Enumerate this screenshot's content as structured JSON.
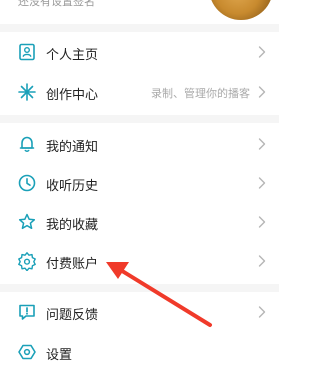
{
  "profile": {
    "status_text": "还没有设置签名"
  },
  "colors": {
    "accent": "#1aa0b8",
    "annotation_arrow": "#f03a2a"
  },
  "menu": {
    "group1": [
      {
        "label": "个人主页",
        "icon": "profile-page-icon",
        "hint": ""
      },
      {
        "label": "创作中心",
        "icon": "creation-center-icon",
        "hint": "录制、管理你的播客"
      }
    ],
    "group2": [
      {
        "label": "我的通知",
        "icon": "bell-icon",
        "hint": ""
      },
      {
        "label": "收听历史",
        "icon": "clock-icon",
        "hint": ""
      },
      {
        "label": "我的收藏",
        "icon": "star-icon",
        "hint": ""
      },
      {
        "label": "付费账户",
        "icon": "paid-badge-icon",
        "hint": ""
      }
    ],
    "group3": [
      {
        "label": "问题反馈",
        "icon": "feedback-icon",
        "hint": ""
      },
      {
        "label": "设置",
        "icon": "settings-icon",
        "hint": ""
      }
    ]
  }
}
